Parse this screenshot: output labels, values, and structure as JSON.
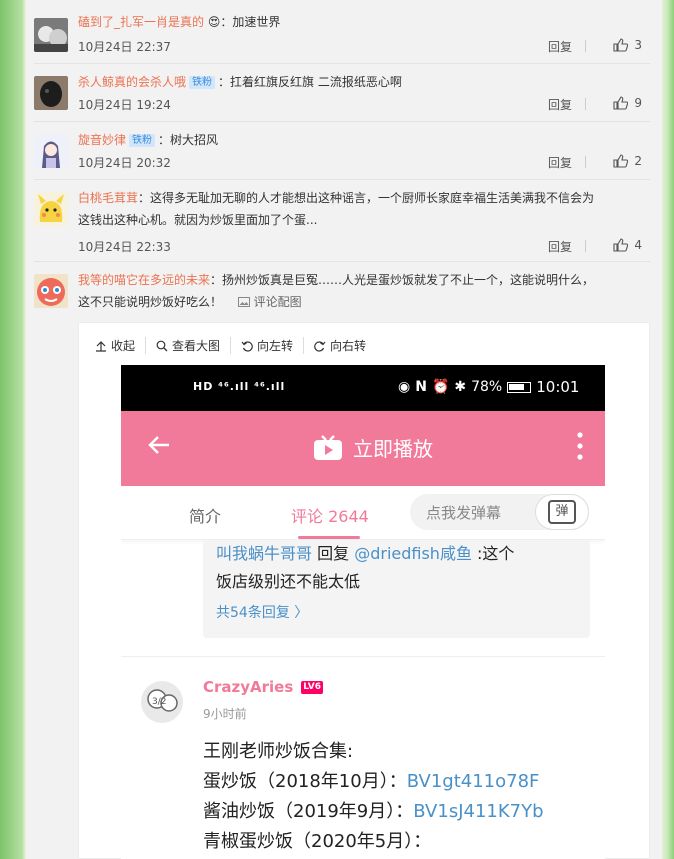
{
  "comments": [
    {
      "user": "磕到了_扎军一肖是真的",
      "badge": "",
      "text": "：加速世界",
      "text2": "",
      "time": "10月24日 22:37",
      "reply": "回复",
      "likes": "3"
    },
    {
      "user": "杀人鲸真的会杀人哦",
      "badge": "铁粉",
      "text": "：扛着红旗反红旗 二流报纸恶心啊",
      "text2": "",
      "time": "10月24日 19:24",
      "reply": "回复",
      "likes": "9"
    },
    {
      "user": "旋音妙律",
      "badge": "铁粉",
      "text": "：树大招风",
      "text2": "",
      "time": "10月24日 20:32",
      "reply": "回复",
      "likes": "2"
    },
    {
      "user": "白桃毛茸茸",
      "badge": "",
      "text": "：这得多无耻加无聊的人才能想出这种谣言，一个厨师长家庭幸福生活美满我不信会为",
      "text2": "这钱出这种心机。就因为炒饭里面加了个蛋...",
      "time": "10月24日 22:33",
      "reply": "回复",
      "likes": "4"
    },
    {
      "user": "我等的喵它在多远的未来",
      "badge": "",
      "text": "：扬州炒饭真是巨冤……人光是蛋炒饭就发了不止一个，这能说明什么，",
      "text2": "这不只能说明炒饭好吃么！",
      "pic_link": "评论配图"
    }
  ],
  "viewer_toolbar": [
    "收起",
    "查看大图",
    "向左转",
    "向右转"
  ],
  "phone": {
    "status_left": "HD ⁴⁶.ıll ⁴⁶.ıll",
    "battery": "78%",
    "time": "10:01",
    "app_title": "立即播放",
    "tab_intro": "简介",
    "tab_comments": "评论 2644",
    "danmaku_placeholder": "点我发弹幕",
    "danmaku_btn": "弹",
    "reply_user": "叫我蜗牛哥哥",
    "reply_verb": " 回复 ",
    "reply_target": "@driedfish咸鱼",
    "reply_text1": " :这个",
    "reply_text2": "饭店级别还不能太低",
    "reply_more": "共54条回复 〉",
    "commenter": "CrazyAries",
    "level": "LV6",
    "comment_time": "9小时前",
    "body_line1": "王刚老师炒饭合集:",
    "line2_prefix": "蛋炒饭（2018年10月）：",
    "line2_bv": "BV1gt411o78F",
    "line3_prefix": "酱油炒饭（2019年9月）：",
    "line3_bv": "BV1sJ411K7Yb",
    "line4": "青椒蛋炒饭（2020年5月）："
  },
  "colors": {
    "username": "#eb7350",
    "badge_bg": "#d0e6fa",
    "badge_fg": "#3d8ede",
    "app_pink": "#f17a9a",
    "link_blue": "#4a90c8"
  }
}
